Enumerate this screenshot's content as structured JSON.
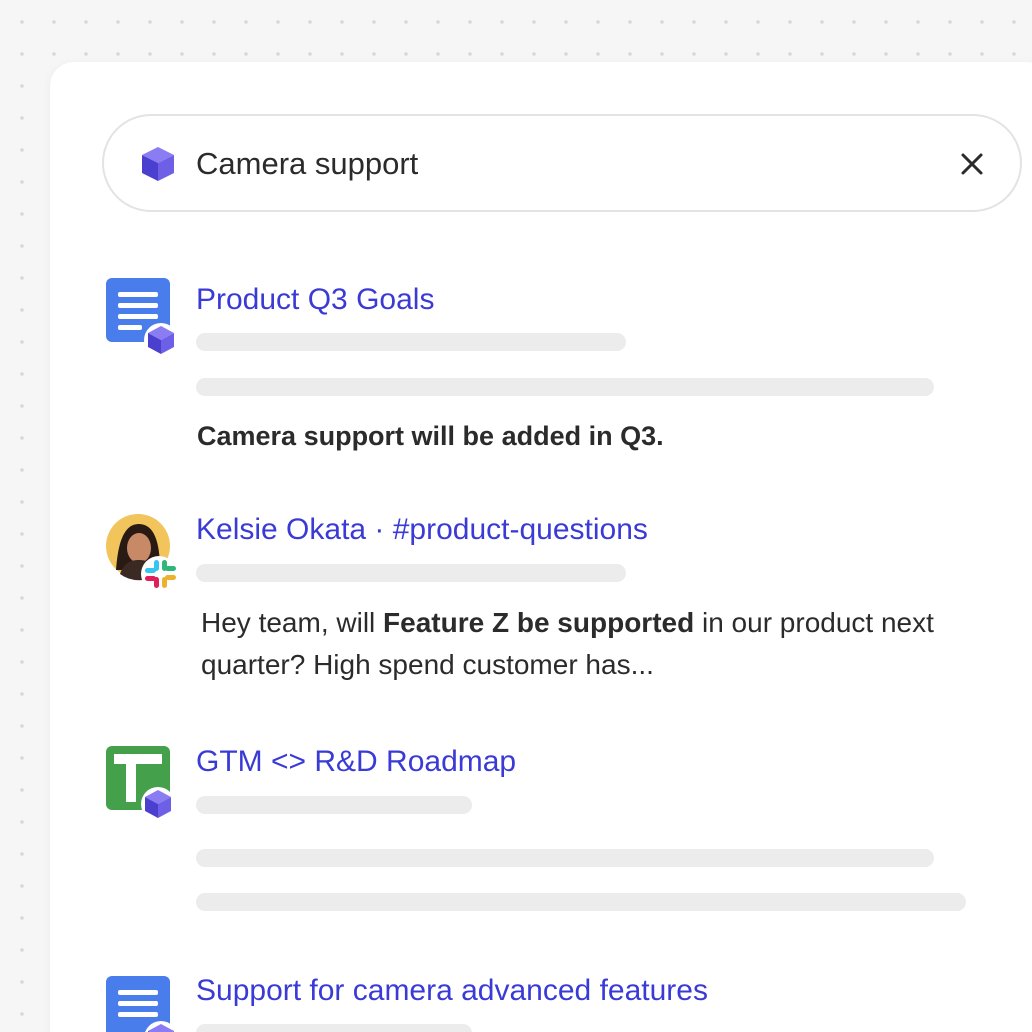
{
  "search": {
    "query": "Camera support",
    "icon": "cube-icon",
    "clear_icon": "close-icon"
  },
  "results": [
    {
      "title": "Product Q3 Goals",
      "icon": "document-icon",
      "source_badge": "cube-icon",
      "snippet": "Camera support will be added in Q3."
    },
    {
      "title": "Kelsie Okata · #product-questions",
      "icon": "avatar",
      "source_badge": "slack-icon",
      "snippet_before": "Hey team, will ",
      "snippet_bold": "Feature Z be supported",
      "snippet_after": " in our product next quarter? High spend customer has..."
    },
    {
      "title": "GTM <> R&D Roadmap",
      "icon": "spreadsheet-icon",
      "source_badge": "cube-icon"
    },
    {
      "title": "Support for camera advanced features",
      "icon": "document-icon",
      "source_badge": "cube-icon"
    }
  ],
  "colors": {
    "accent": "#3a3ad6",
    "cube": "#6c5ce7",
    "doc_blue": "#4a7dec",
    "sheet_green": "#44a04a",
    "avatar_bg": "#f2c55c"
  }
}
